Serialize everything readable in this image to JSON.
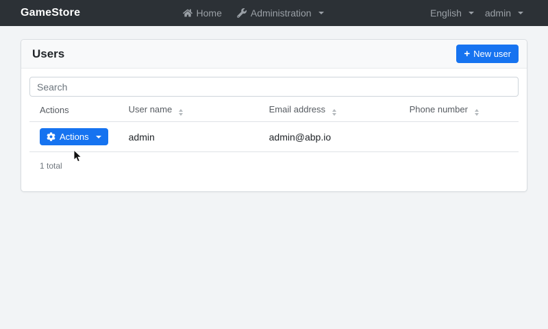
{
  "navbar": {
    "brand": "GameStore",
    "menu": [
      {
        "label": "Home",
        "icon": "home-icon"
      },
      {
        "label": "Administration",
        "icon": "wrench-icon"
      }
    ],
    "language_selector": "English",
    "current_user": "admin"
  },
  "page": {
    "title": "Users",
    "new_user_button": {
      "plus": "+",
      "label": "New user"
    }
  },
  "search": {
    "placeholder": "Search",
    "value": ""
  },
  "table": {
    "headers": [
      "Actions",
      "User name",
      "Email address",
      "Phone number"
    ],
    "row": {
      "actions_button_label": "Actions",
      "user_name": "admin",
      "email": "admin@abp.io",
      "phone": ""
    },
    "total": "1 total"
  },
  "icons": {
    "home": "home-icon",
    "administration": "wrench-icon",
    "dropdown": "chevron-down-icon",
    "actions": "gear-icon",
    "new_user": "plus-icon",
    "sort": "sort-icon",
    "pointer": "mouse-cursor"
  },
  "colors": {
    "navbar_bg": "#2c3136",
    "navbar_link": "#9aa0a6",
    "accent_blue": "#1673f0",
    "page_bg": "#f2f4f6",
    "card_header_bg": "#f8f9fa",
    "table_border": "#dee2e6",
    "muted_text": "#6e757c"
  }
}
